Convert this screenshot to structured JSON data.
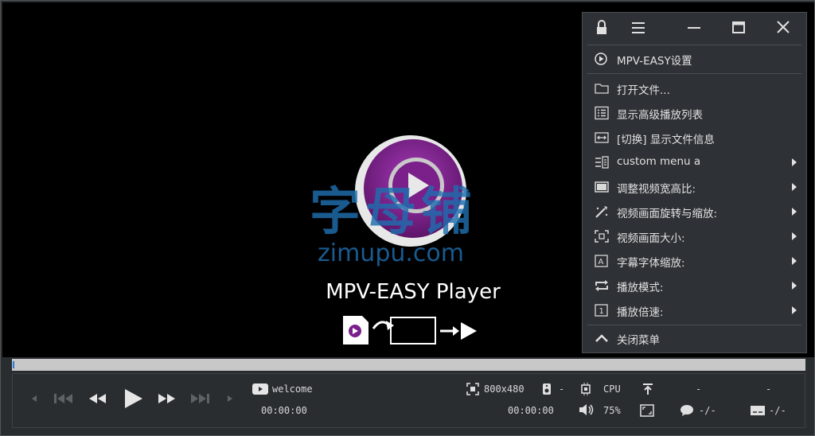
{
  "watermark": {
    "cn": "字母铺",
    "en": "zimupu.com"
  },
  "player_title": "MPV-EASY Player",
  "menu": {
    "header": "MPV-EASY设置",
    "items": [
      {
        "label": "打开文件...",
        "icon": "folder-icon",
        "submenu": false
      },
      {
        "label": "显示高级播放列表",
        "icon": "list-icon",
        "submenu": false
      },
      {
        "label": "[切换] 显示文件信息",
        "icon": "info-toggle-icon",
        "submenu": false
      },
      {
        "label": "custom menu a",
        "icon": "custom-menu-icon",
        "submenu": true
      },
      {
        "label": "调整视频宽高比:",
        "icon": "aspect-ratio-icon",
        "submenu": true
      },
      {
        "label": "视频画面旋转与缩放:",
        "icon": "rotate-zoom-icon",
        "submenu": true
      },
      {
        "label": "视频画面大小:",
        "icon": "video-size-icon",
        "submenu": true
      },
      {
        "label": "字幕字体缩放:",
        "icon": "subtitle-font-icon",
        "submenu": true
      },
      {
        "label": "播放模式:",
        "icon": "play-mode-icon",
        "submenu": true
      },
      {
        "label": "播放倍速:",
        "icon": "speed-icon",
        "submenu": true
      }
    ],
    "close": "关闭菜单"
  },
  "controls": {
    "now_playing": "welcome",
    "time_elapsed": "00:00:00",
    "time_total": "00:00:00",
    "resolution": "800x480",
    "hwdec": "CPU",
    "volume": "75%",
    "audio_track": "-",
    "dash_1": "-",
    "dash_2": "-",
    "subtitle": "-/-",
    "sub_track": "-/-"
  },
  "colors": {
    "accent": "#2a7bd6",
    "logo_purple": "#7b1f8a",
    "background": "#2a2d30"
  }
}
